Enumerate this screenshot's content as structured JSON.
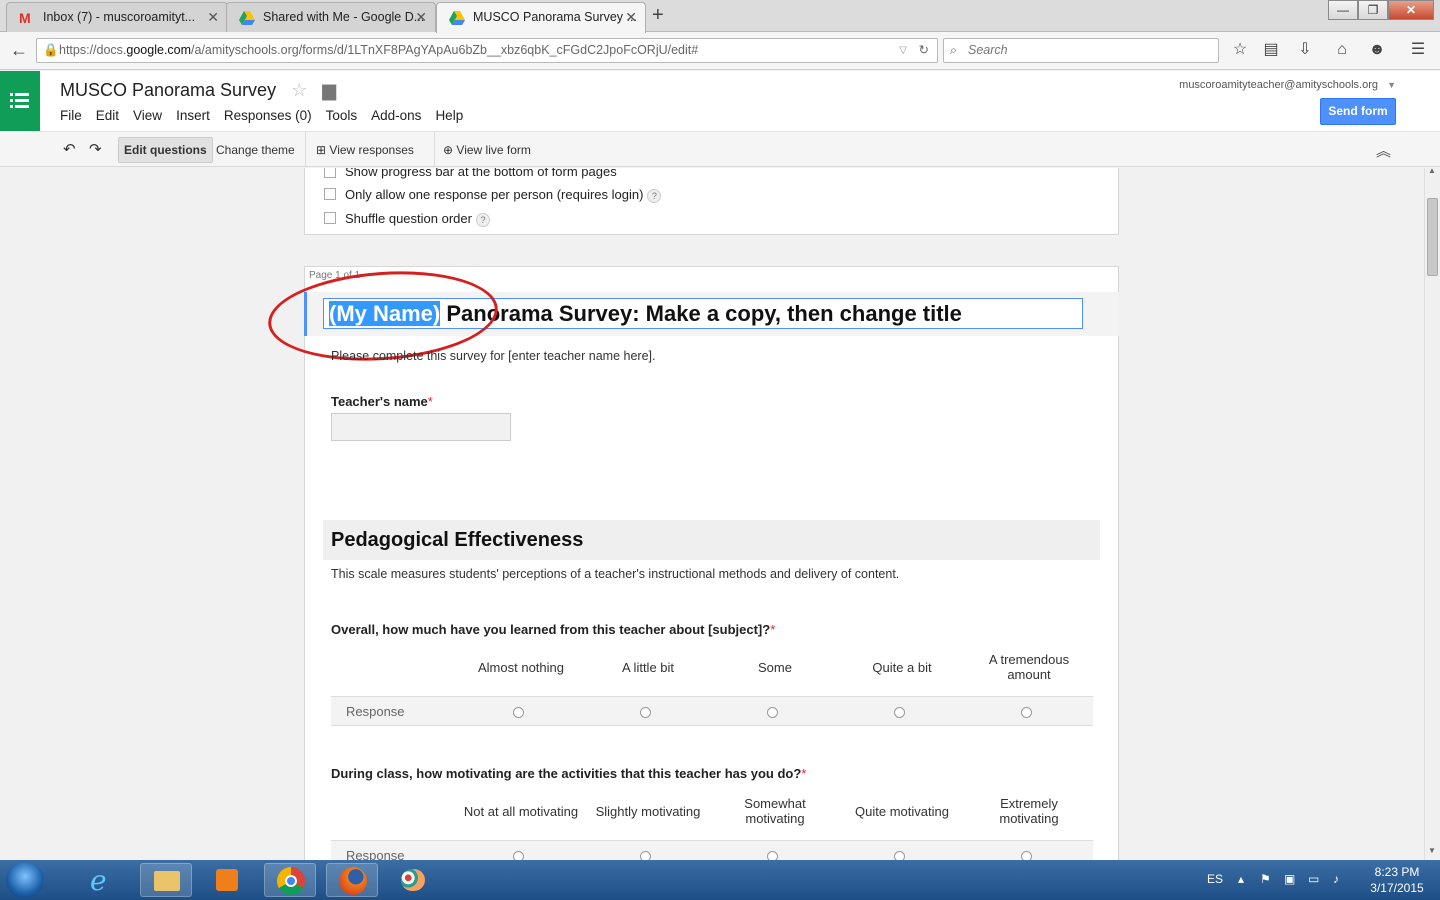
{
  "browser": {
    "tabs": [
      {
        "label": "Inbox (7) - muscoroamityt..."
      },
      {
        "label": "Shared with Me - Google D..."
      },
      {
        "label": "MUSCO Panorama Survey ..."
      }
    ],
    "url_prefix": "https://docs.",
    "url_domain": "google.com",
    "url_rest": "/a/amityschools.org/forms/d/1LTnXF8PAgYApAu6bZb__xbz6qbK_cFGdC2JpoFcORjU/edit#",
    "search_placeholder": "Search"
  },
  "app": {
    "doc_title": "MUSCO Panorama Survey",
    "menu": [
      "File",
      "Edit",
      "View",
      "Insert",
      "Responses (0)",
      "Tools",
      "Add-ons",
      "Help"
    ],
    "account": "muscoroamityteacher@amityschools.org",
    "send_label": "Send form"
  },
  "toolbar": {
    "edit_questions": "Edit questions",
    "change_theme": "Change theme",
    "view_responses": "View responses",
    "view_live_form": "View live form"
  },
  "settings": {
    "progress": "Show progress bar at the bottom of form pages",
    "one_response": "Only allow one response per person (requires login)",
    "shuffle": "Shuffle question order"
  },
  "page_label": "Page 1 of 1",
  "form": {
    "title_selected": "(My Name)",
    "title_rest": " Panorama Survey: Make a copy, then change title",
    "description": "Please complete this survey for [enter teacher name here].",
    "teacher_q": "Teacher's name",
    "required_mark": "*",
    "section_title": "Pedagogical Effectiveness",
    "section_desc": "This scale measures students' perceptions of a teacher's instructional methods and delivery of content.",
    "q1": {
      "label": "Overall, how much have you learned from this teacher about [subject]?",
      "columns": [
        "Almost nothing",
        "A little bit",
        "Some",
        "Quite a bit",
        "A tremendous amount"
      ],
      "row": "Response"
    },
    "q2": {
      "label": "During class, how motivating are the activities that this teacher has you do?",
      "columns": [
        "Not at all motivating",
        "Slightly motivating",
        "Somewhat motivating",
        "Quite motivating",
        "Extremely motivating"
      ],
      "row": "Response"
    }
  },
  "taskbar": {
    "lang": "ES",
    "time": "8:23 PM",
    "date": "3/17/2015"
  }
}
